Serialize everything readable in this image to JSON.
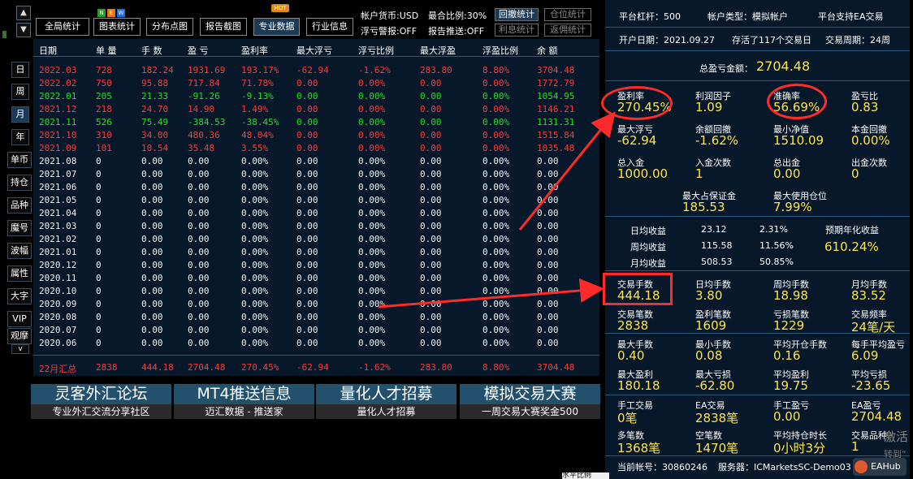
{
  "nav": {
    "up": "▲",
    "down": "▼",
    "more": "v"
  },
  "sidebar": {
    "items": [
      "日",
      "周",
      "月",
      "年",
      "单币",
      "持仓",
      "品种",
      "魔号",
      "波幅",
      "属性",
      "大字",
      "VIP",
      "观摩"
    ]
  },
  "toolbar": {
    "buttons": [
      "全局统计",
      "图表统计",
      "分布点图",
      "报告截图",
      "专业数据",
      "行业信息"
    ],
    "new_badge": [
      "N",
      "E",
      "W"
    ],
    "hot_badge": "HOT",
    "info1": "帐户货币:USD",
    "info2": "最合比例:30%",
    "info3": "浮亏警报:OFF",
    "info4": "报告推送:OFF",
    "b1": "回撤统计",
    "b2": "仓位统计",
    "b3": "利息统计",
    "b4": "返佣统计"
  },
  "table": {
    "headers": [
      "日期",
      "单 量",
      "手 数",
      "盈 亏",
      "盈利率",
      "最大浮亏",
      "浮亏比例",
      "最大浮盈",
      "浮盈比例",
      "余 额"
    ],
    "rows": [
      [
        "red",
        "2022.03",
        "728",
        "182.24",
        "1931.69",
        "193.17%",
        "-62.94",
        "-1.62%",
        "283.80",
        "8.80%",
        "3704.48"
      ],
      [
        "red",
        "2022.02",
        "750",
        "95.88",
        "717.84",
        "71.78%",
        "0.00",
        "0.00%",
        "0.00",
        "0.00%",
        "1772.79"
      ],
      [
        "grn",
        "2022.01",
        "205",
        "21.33",
        "-91.26",
        "-9.13%",
        "0.00",
        "0.00%",
        "0.00",
        "0.00%",
        "1054.95"
      ],
      [
        "red",
        "2021.12",
        "218",
        "24.70",
        "14.90",
        "1.49%",
        "0.00",
        "0.00%",
        "0.00",
        "0.00%",
        "1146.21"
      ],
      [
        "grn",
        "2021.11",
        "526",
        "75.49",
        "-384.53",
        "-38.45%",
        "0.00",
        "0.00%",
        "0.00",
        "0.00%",
        "1131.31"
      ],
      [
        "red",
        "2021.10",
        "310",
        "34.00",
        "480.36",
        "48.04%",
        "0.00",
        "0.00%",
        "0.00",
        "0.00%",
        "1515.84"
      ],
      [
        "red",
        "2021.09",
        "101",
        "10.54",
        "35.48",
        "3.55%",
        "0.00",
        "0.00%",
        "0.00",
        "0.00%",
        "1035.48"
      ],
      [
        "wht",
        "2021.08",
        "0",
        "0.00",
        "0.00",
        "0.00%",
        "0.00",
        "0.00%",
        "0.00",
        "0.00%",
        "0.00"
      ],
      [
        "wht",
        "2021.07",
        "0",
        "0.00",
        "0.00",
        "0.00%",
        "0.00",
        "0.00%",
        "0.00",
        "0.00%",
        "0.00"
      ],
      [
        "wht",
        "2021.06",
        "0",
        "0.00",
        "0.00",
        "0.00%",
        "0.00",
        "0.00%",
        "0.00",
        "0.00%",
        "0.00"
      ],
      [
        "wht",
        "2021.05",
        "0",
        "0.00",
        "0.00",
        "0.00%",
        "0.00",
        "0.00%",
        "0.00",
        "0.00%",
        "0.00"
      ],
      [
        "wht",
        "2021.04",
        "0",
        "0.00",
        "0.00",
        "0.00%",
        "0.00",
        "0.00%",
        "0.00",
        "0.00%",
        "0.00"
      ],
      [
        "wht",
        "2021.03",
        "0",
        "0.00",
        "0.00",
        "0.00%",
        "0.00",
        "0.00%",
        "0.00",
        "0.00%",
        "0.00"
      ],
      [
        "wht",
        "2021.02",
        "0",
        "0.00",
        "0.00",
        "0.00%",
        "0.00",
        "0.00%",
        "0.00",
        "0.00%",
        "0.00"
      ],
      [
        "wht",
        "2021.01",
        "0",
        "0.00",
        "0.00",
        "0.00%",
        "0.00",
        "0.00%",
        "0.00",
        "0.00%",
        "0.00"
      ],
      [
        "wht",
        "2020.12",
        "0",
        "0.00",
        "0.00",
        "0.00%",
        "0.00",
        "0.00%",
        "0.00",
        "0.00%",
        "0.00"
      ],
      [
        "wht",
        "2020.11",
        "0",
        "0.00",
        "0.00",
        "0.00%",
        "0.00",
        "0.00%",
        "0.00",
        "0.00%",
        "0.00"
      ],
      [
        "wht",
        "2020.10",
        "0",
        "0.00",
        "0.00",
        "0.00%",
        "0.00",
        "0.00%",
        "0.00",
        "0.00%",
        "0.00"
      ],
      [
        "wht",
        "2020.09",
        "0",
        "0.00",
        "0.00",
        "0.00%",
        "0.00",
        "0.00%",
        "0.00",
        "0.00%",
        "0.00"
      ],
      [
        "wht",
        "2020.08",
        "0",
        "0.00",
        "0.00",
        "0.00%",
        "0.00",
        "0.00%",
        "0.00",
        "0.00%",
        "0.00"
      ],
      [
        "wht",
        "2020.07",
        "0",
        "0.00",
        "0.00",
        "0.00%",
        "0.00",
        "0.00%",
        "0.00",
        "0.00%",
        "0.00"
      ],
      [
        "wht",
        "2020.06",
        "0",
        "0.00",
        "0.00",
        "0.00%",
        "0.00",
        "0.00%",
        "0.00",
        "0.00%",
        "0.00"
      ]
    ],
    "summary": [
      "22月汇总",
      "2838",
      "444.18",
      "2704.48",
      "270.45%",
      "-62.94",
      "-1.62%",
      "283.80",
      "8.80%",
      "3704.48"
    ]
  },
  "banners": [
    {
      "title": "灵客外汇论坛",
      "sub": "专业外汇交流分享社区"
    },
    {
      "title": "MT4推送信息",
      "sub": "迈汇数据 - 推送家"
    },
    {
      "title": "量化人才招募",
      "sub": "量化人才招募"
    },
    {
      "title": "模拟交易大赛",
      "sub": "一周交易大赛奖金500"
    }
  ],
  "right": {
    "top": [
      "平台杠杆：500",
      "帐户类型：模拟帐户",
      "平台支持EA交易"
    ],
    "open": [
      "开户日期：2021.09.27",
      "存活了117个交易日",
      "交易周期：24周"
    ],
    "total_label": "总盈亏金额：",
    "total_value": "2704.48",
    "g1": [
      [
        "盈利率",
        "270.45%"
      ],
      [
        "利润因子",
        "1.09"
      ],
      [
        "准确率",
        "56.69%"
      ],
      [
        "盈亏比",
        "0.83"
      ],
      [
        "最大浮亏",
        "-62.94"
      ],
      [
        "余额回撤",
        "-1.62%"
      ],
      [
        "最小净值",
        "1510.09"
      ],
      [
        "本金回撤",
        "0.00%"
      ],
      [
        "总入金",
        "1000.00"
      ],
      [
        "入金次数",
        "1"
      ],
      [
        "总出金",
        "0.00"
      ],
      [
        "出金次数",
        "0"
      ]
    ],
    "margin": [
      [
        "最大占保证金",
        "185.53"
      ],
      [
        "最大使用仓位",
        "7.99%"
      ]
    ],
    "returns": [
      [
        "日均收益",
        "23.12",
        "2.31%"
      ],
      [
        "周均收益",
        "115.58",
        "11.56%"
      ],
      [
        "月均收益",
        "508.53",
        "50.85%"
      ]
    ],
    "annual_label": "预期年化收益",
    "annual_value": "610.24%",
    "g2": [
      [
        "交易手数",
        "444.18"
      ],
      [
        "日均手数",
        "3.80"
      ],
      [
        "周均手数",
        "18.98"
      ],
      [
        "月均手数",
        "83.52"
      ],
      [
        "交易笔数",
        "2838"
      ],
      [
        "盈利笔数",
        "1609"
      ],
      [
        "亏损笔数",
        "1229"
      ],
      [
        "交易频率",
        "24笔/天"
      ]
    ],
    "g3": [
      [
        "最大手数",
        "0.40"
      ],
      [
        "最小手数",
        "0.08"
      ],
      [
        "平均开仓手数",
        "0.16"
      ],
      [
        "每手平均盈亏",
        "6.09"
      ],
      [
        "最大盈利",
        "180.18"
      ],
      [
        "最大亏损",
        "-62.80"
      ],
      [
        "平均盈利",
        "19.75"
      ],
      [
        "平均亏损",
        "-23.65"
      ]
    ],
    "g4": [
      [
        "手工交易",
        "0笔"
      ],
      [
        "EA交易",
        "2838笔"
      ],
      [
        "手工盈亏",
        "0.00"
      ],
      [
        "EA盈亏",
        "2704.48"
      ],
      [
        "多笔数",
        "1368笔"
      ],
      [
        "空笔数",
        "1470笔"
      ],
      [
        "平均持仓时长",
        "0小时3分"
      ],
      [
        "交易品种",
        "1"
      ]
    ],
    "footer": [
      "当前帐号：30860246",
      "服务器：ICMarketsSC-Demo03"
    ],
    "watermark": [
      "激活",
      "转到“"
    ],
    "eahub": "EAHub",
    "tooltip": "水平比例"
  },
  "colors": {
    "accent_red": "#ff2a2a",
    "yellow": "#ffe44a",
    "panel": "#061829"
  }
}
